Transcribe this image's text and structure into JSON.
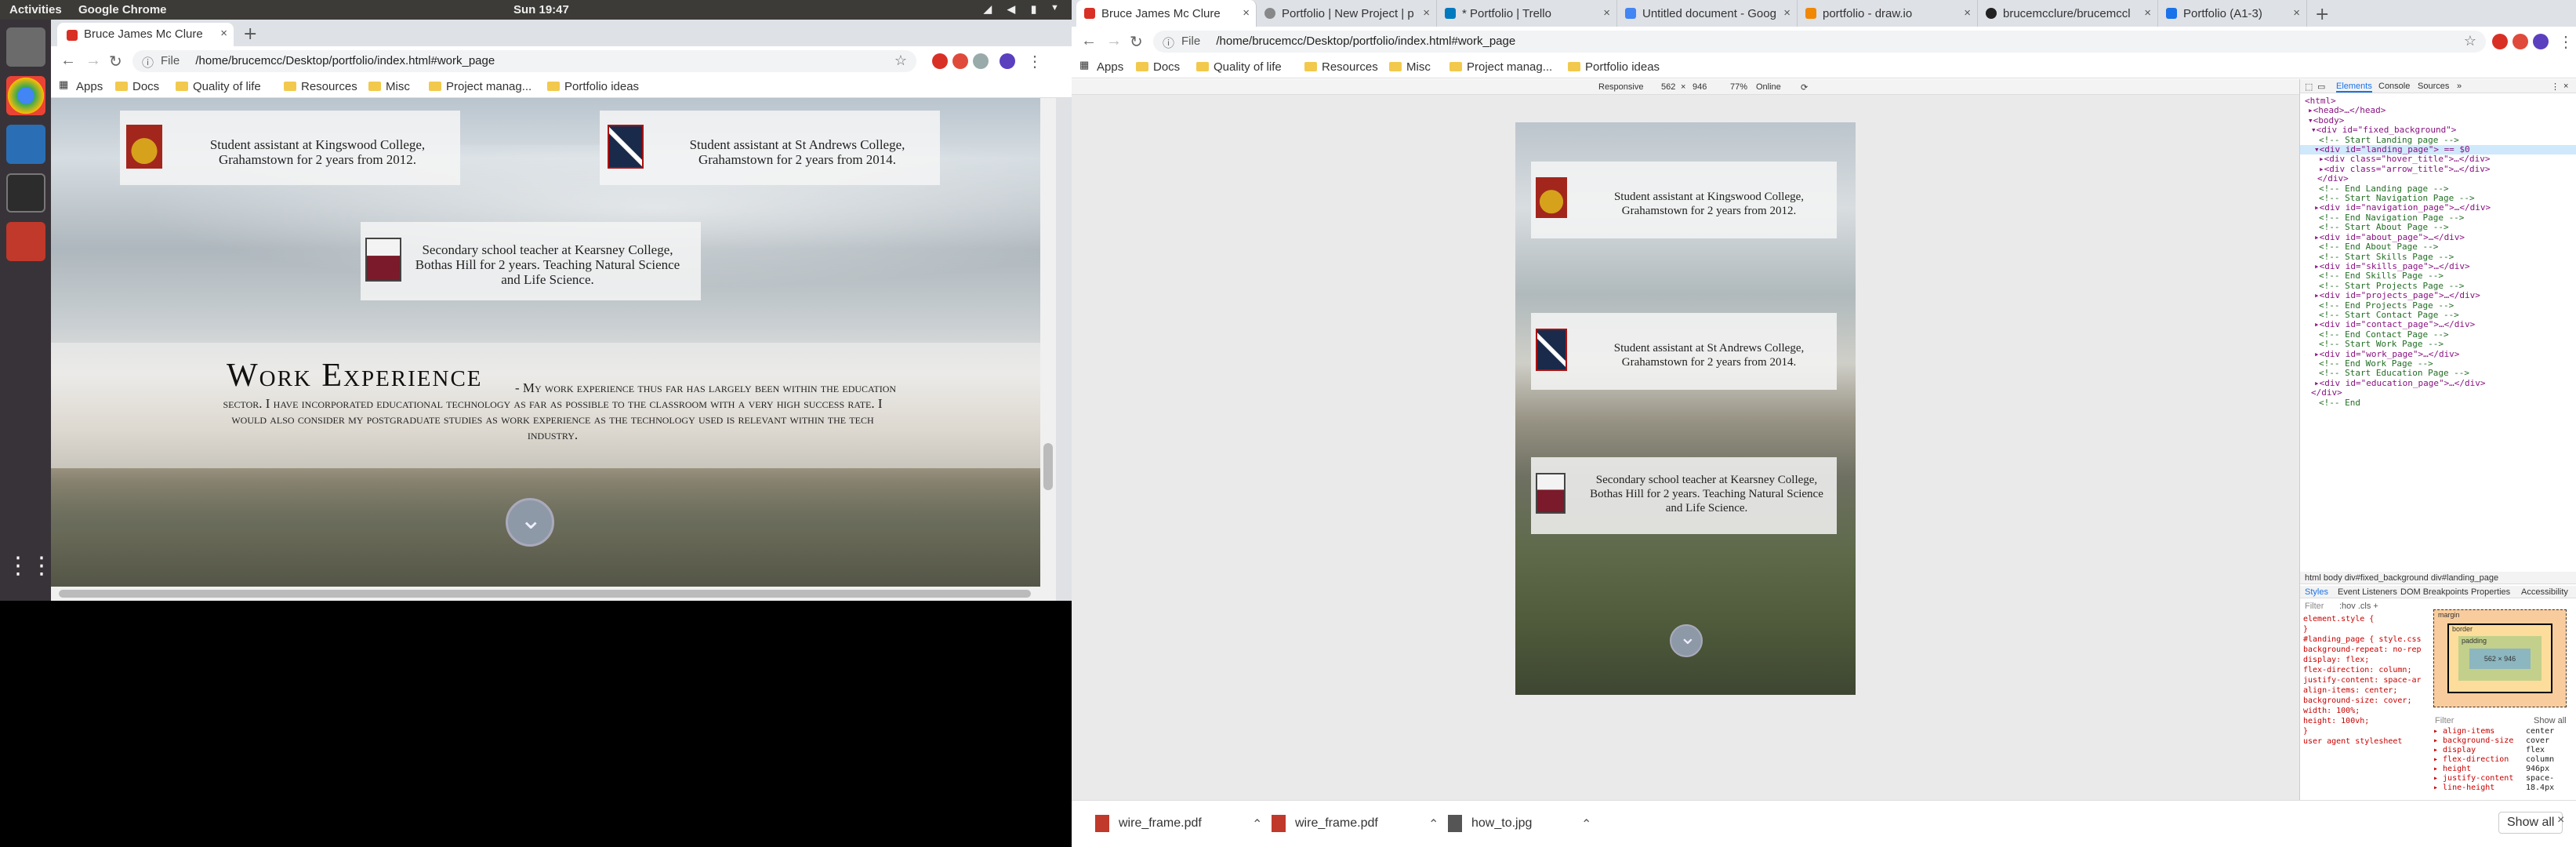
{
  "topbar": {
    "activities": "Activities",
    "app": "Google Chrome",
    "clock": "Sun 19:47"
  },
  "left": {
    "tab_title": "Bruce James Mc Clure",
    "url_scheme": "File",
    "url": "/home/brucemcc/Desktop/portfolio/index.html#work_page",
    "bookmarks": [
      "Apps",
      "Docs",
      "Quality of life",
      "Resources",
      "Misc",
      "Project manag...",
      "Portfolio ideas"
    ],
    "page": {
      "card1": "Student assistant at Kingswood College, Grahamstown for 2 years from 2012.",
      "card2": "Student assistant at St Andrews College, Grahamstown for 2 years from 2014.",
      "card3": "Secondary school teacher at Kearsney College, Bothas Hill for 2 years. Teaching Natural Science and Life Science.",
      "work_title": "Work Experience",
      "work_text": "- My work experience thus far has largely been within the education sector. I have incorporated educational technology as far as possible to the classroom with a very high success rate. I would also consider my postgraduate studies as work experience as the technology used is relevant within the tech industry."
    }
  },
  "right": {
    "tabs": [
      "Bruce James Mc Clure",
      "Portfolio | New Project | p",
      "* Portfolio | Trello",
      "Untitled document - Goog",
      "portfolio - draw.io",
      "brucemcclure/brucemccl",
      "Portfolio (A1-3)"
    ],
    "url_scheme": "File",
    "url": "/home/brucemcc/Desktop/portfolio/index.html#work_page",
    "bookmarks": [
      "Apps",
      "Docs",
      "Quality of life",
      "Resources",
      "Misc",
      "Project manag...",
      "Portfolio ideas"
    ],
    "device": {
      "mode": "Responsive",
      "width": "562",
      "x": "×",
      "height": "946",
      "zoom": "77%",
      "net": "Online"
    },
    "page": {
      "card1": "Student assistant at Kingswood College, Grahamstown for 2 years from 2012.",
      "card2": "Student assistant at St Andrews College, Grahamstown for 2 years from 2014.",
      "card3": "Secondary school teacher at Kearsney College, Bothas Hill for 2 years. Teaching Natural Science and Life Science."
    },
    "devtools": {
      "tabs": [
        "Elements",
        "Console",
        "Sources"
      ],
      "dom": [
        "<html>",
        "▸<head>…</head>",
        "▾<body>",
        "▾<div id=\"fixed_background\">",
        "<!-- Start Landing page -->",
        "▾<div id=\"landing_page\"> == $0",
        "▸<div class=\"hover_title\">…</div>",
        "▸<div class=\"arrow_title\">…</div>",
        "</div>",
        "<!-- End Landing page -->",
        "<!-- Start Navigation Page -->",
        "▸<div id=\"navigation_page\">…</div>",
        "<!-- End Navigation Page -->",
        "<!-- Start About Page -->",
        "▸<div id=\"about_page\">…</div>",
        "<!-- End About Page -->",
        "<!-- Start Skills Page -->",
        "▸<div id=\"skills_page\">…</div>",
        "<!-- End Skills Page -->",
        "<!-- Start Projects Page -->",
        "▸<div id=\"projects_page\">…</div>",
        "<!-- End Projects Page -->",
        "<!-- Start Contact Page -->",
        "▸<div id=\"contact_page\">…</div>",
        "<!-- End Contact Page -->",
        "<!-- Start Work Page -->",
        "▸<div id=\"work_page\">…</div>",
        "<!-- End Work Page -->",
        "<!-- Start Education Page -->",
        "▸<div id=\"education_page\">…</div>",
        "</div>",
        "<!-- End"
      ],
      "crumbs": "html  body  div#fixed_background  div#landing_page",
      "style_tabs": [
        "Styles",
        "Event Listeners",
        "DOM Breakpoints",
        "Properties",
        "Accessibility"
      ],
      "filter": "Filter",
      "hov": ":hov  .cls  +",
      "rules": [
        "element.style {",
        "}",
        "#landing_page {     style.css:12",
        "  background-repeat: no-repeat;",
        "  display: flex;",
        "  flex-direction: column;",
        "  justify-content: space-around;",
        "  align-items: center;",
        "  background-size: cover;",
        "  width: 100%;",
        "  height: 100vh;",
        "}",
        "user agent stylesheet"
      ],
      "box": {
        "label": "margin",
        "border": "border",
        "padding": "padding",
        "content": "562 × 946"
      },
      "computed_filter": "Filter",
      "show_all": "Show all",
      "computed": [
        [
          "align-items",
          "center"
        ],
        [
          "background-size",
          "cover"
        ],
        [
          "display",
          "flex"
        ],
        [
          "flex-direction",
          "column"
        ],
        [
          "height",
          "946px"
        ],
        [
          "justify-content",
          "space-"
        ],
        [
          "line-height",
          "18.4px"
        ]
      ]
    },
    "downloads": [
      "wire_frame.pdf",
      "wire_frame.pdf",
      "how_to.jpg"
    ],
    "show_all": "Show all"
  },
  "colors": {
    "topbar": "#3c3b37",
    "launcher": "#383338",
    "chrome_red": "#d93025"
  }
}
